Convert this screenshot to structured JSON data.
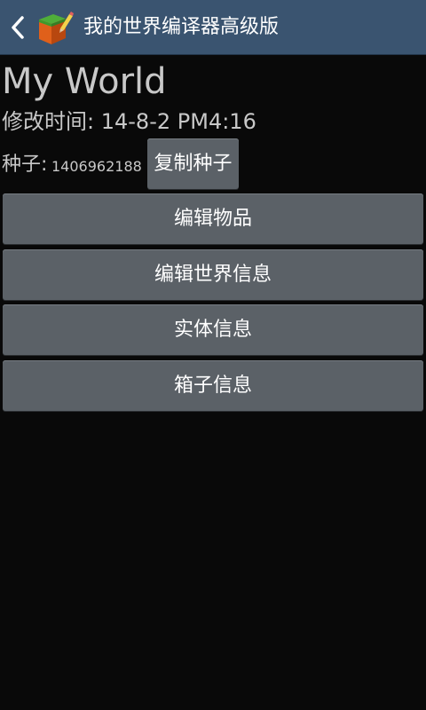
{
  "action_bar": {
    "title": "我的世界编译器高级版",
    "back_icon": "chevron-left-icon",
    "app_icon": "grass-block-pencil-icon"
  },
  "world": {
    "name": "My World",
    "modified_label": "修改时间:",
    "modified_value": "14-8-2 PM4:16",
    "seed_label": "种子:",
    "seed_value": "1406962188",
    "copy_seed_label": "复制种子"
  },
  "menu": {
    "items": [
      {
        "label": "编辑物品"
      },
      {
        "label": "编辑世界信息"
      },
      {
        "label": "实体信息"
      },
      {
        "label": "箱子信息"
      }
    ]
  },
  "colors": {
    "action_bar_bg": "#3a5470",
    "background": "#090909",
    "button_bg": "#5b6167",
    "text_primary": "#c8c8c8",
    "button_text": "#ffffff"
  }
}
